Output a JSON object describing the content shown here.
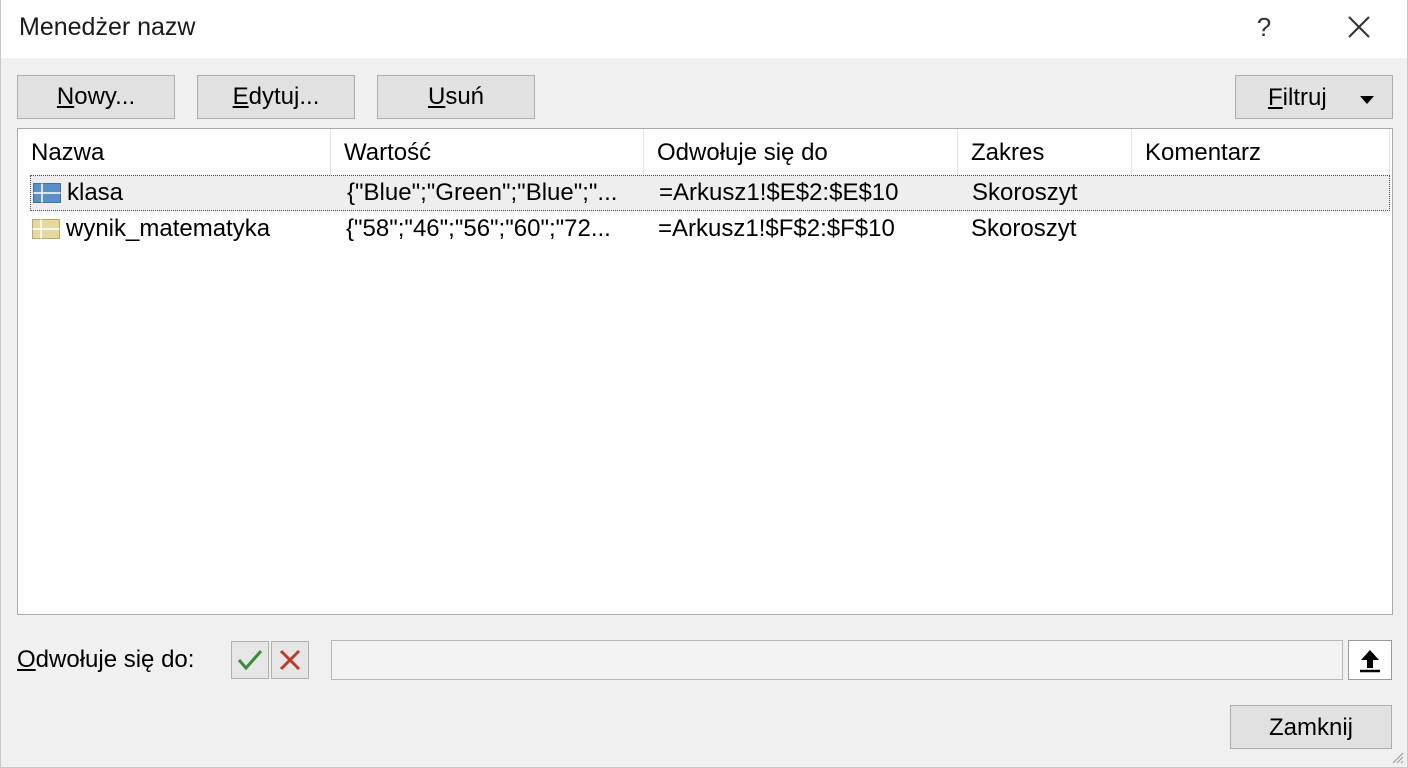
{
  "window": {
    "title": "Menedżer nazw",
    "help_label": "?",
    "close_label": "✕"
  },
  "toolbar": {
    "new": {
      "pre": "",
      "key": "N",
      "post": "owy..."
    },
    "edit": {
      "pre": "",
      "key": "E",
      "post": "dytuj..."
    },
    "delete": {
      "pre": "",
      "key": "U",
      "post": "suń"
    },
    "filter": {
      "pre": "",
      "key": "F",
      "post": "iltruj"
    }
  },
  "table": {
    "columns": [
      "Nazwa",
      "Wartość",
      "Odwołuje się do",
      "Zakres",
      "Komentarz"
    ],
    "rows": [
      {
        "name": "klasa",
        "value": "{\"Blue\";\"Green\";\"Blue\";\"...",
        "refers_to": "=Arkusz1!$E$2:$E$10",
        "scope": "Skoroszyt",
        "comment": "",
        "selected": true
      },
      {
        "name": "wynik_matematyka",
        "value": "{\"58\";\"46\";\"56\";\"60\";\"72...",
        "refers_to": "=Arkusz1!$F$2:$F$10",
        "scope": "Skoroszyt",
        "comment": "",
        "selected": false
      }
    ]
  },
  "refers_to_field": {
    "label_key": "O",
    "label_rest": "dwołuje się do:",
    "value": ""
  },
  "close_button": "Zamknij",
  "colors": {
    "accept": "#3a8a3a",
    "cancel": "#c0392b",
    "icon_blue": "#5b8fc7",
    "icon_yellow": "#e6d9a0"
  }
}
